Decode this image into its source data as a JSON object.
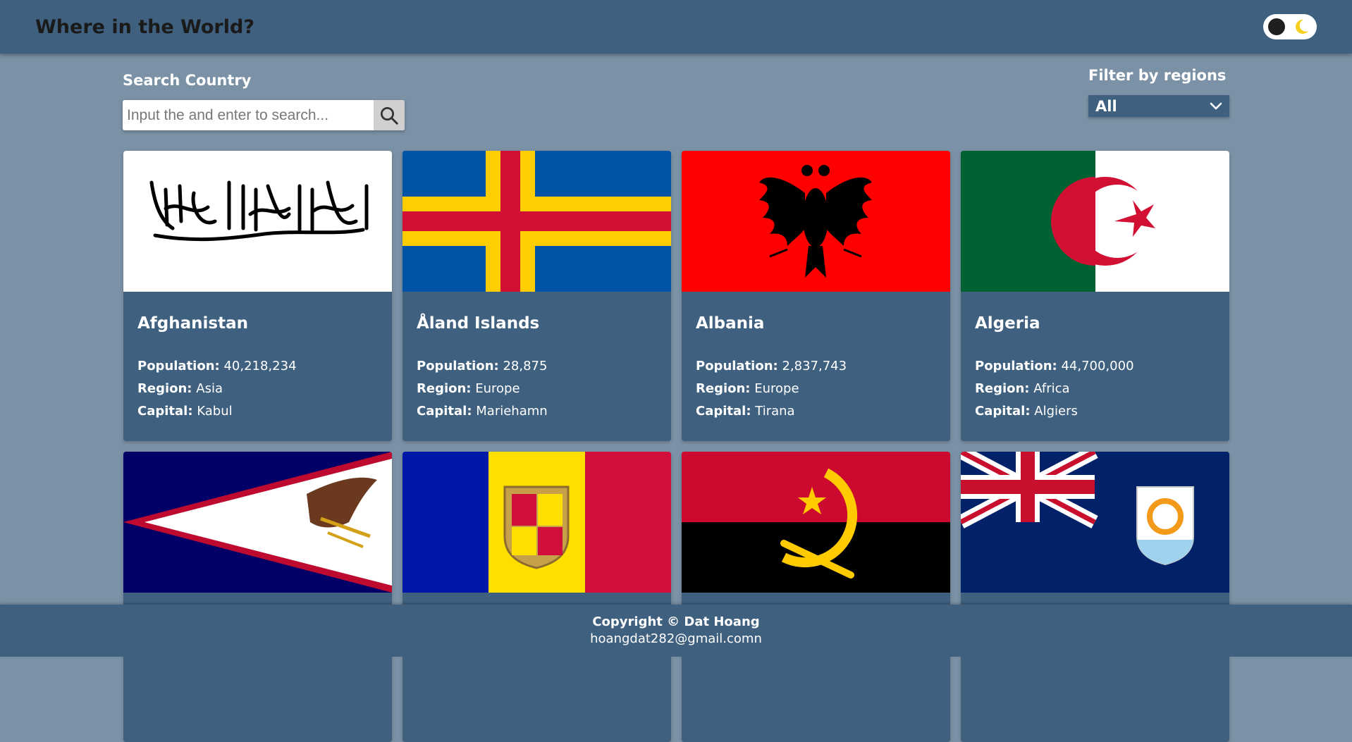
{
  "header": {
    "title": "Where in the World?",
    "toggle_icon": "moon-icon"
  },
  "search": {
    "label": "Search Country",
    "placeholder": "Input the and enter to search...",
    "icon": "search-icon"
  },
  "filter": {
    "label": "Filter by regions",
    "selected": "All"
  },
  "labels": {
    "population": "Population:",
    "region": "Region:",
    "capital": "Capital:"
  },
  "countries": [
    {
      "name": "Afghanistan",
      "population": "40,218,234",
      "region": "Asia",
      "capital": "Kabul"
    },
    {
      "name": "Åland Islands",
      "population": "28,875",
      "region": "Europe",
      "capital": "Mariehamn"
    },
    {
      "name": "Albania",
      "population": "2,837,743",
      "region": "Europe",
      "capital": "Tirana"
    },
    {
      "name": "Algeria",
      "population": "44,700,000",
      "region": "Africa",
      "capital": "Algiers"
    },
    {
      "name": "",
      "population": "",
      "region": "",
      "capital": ""
    },
    {
      "name": "",
      "population": "",
      "region": "",
      "capital": ""
    },
    {
      "name": "",
      "population": "",
      "region": "",
      "capital": ""
    },
    {
      "name": "",
      "population": "",
      "region": "",
      "capital": ""
    }
  ],
  "footer": {
    "copyright": "Copyright © Dat Hoang",
    "email": "hoangdat282@gmail.comn"
  },
  "colors": {
    "background": "#7b91a5",
    "panel": "#3f617f"
  }
}
